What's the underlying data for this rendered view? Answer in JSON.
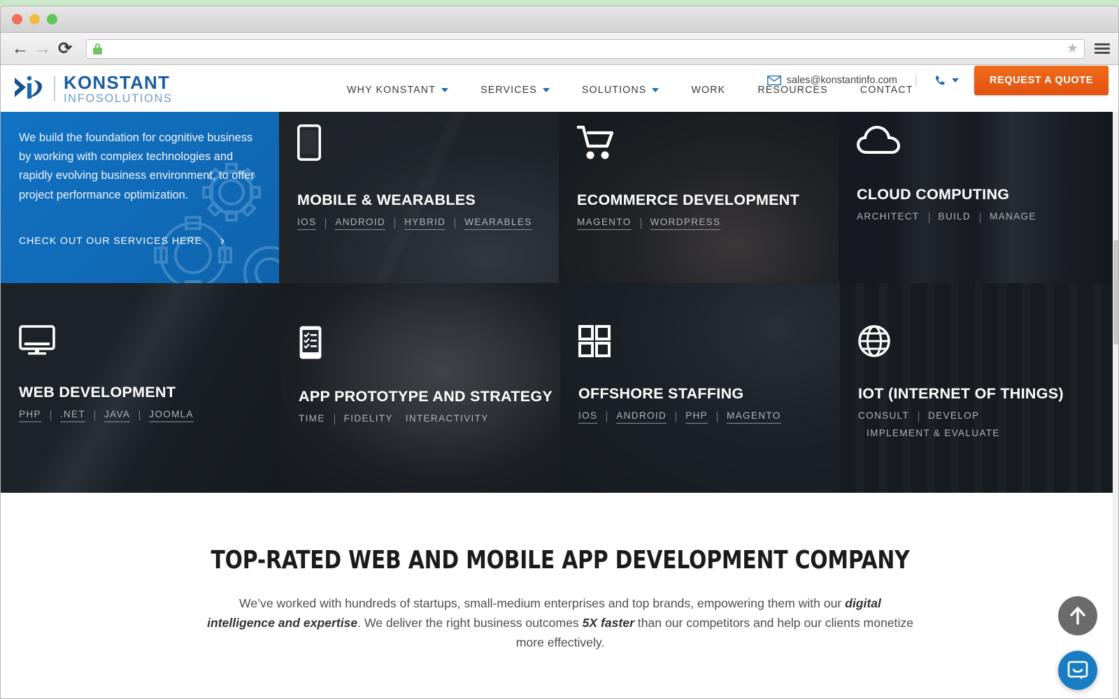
{
  "browser": {
    "back_icon": "back-arrow-icon",
    "forward_icon": "forward-arrow-icon",
    "reload_icon": "reload-icon",
    "url_value": "",
    "url_placeholder": "",
    "lock_icon": "secure-lock-icon",
    "bookmark_icon": "star-icon",
    "menu_icon": "hamburger-menu-icon"
  },
  "header": {
    "logo": {
      "primary": "KONSTANT",
      "secondary": "INFOSOLUTIONS"
    },
    "email": "sales@konstantinfo.com",
    "mail_icon": "envelope-icon",
    "phone_icon": "phone-icon",
    "quote_button": "REQUEST A QUOTE",
    "accent_orange": "#e2520f",
    "nav": [
      {
        "label": "WHY KONSTANT",
        "has_dropdown": true
      },
      {
        "label": "SERVICES",
        "has_dropdown": true
      },
      {
        "label": "SOLUTIONS",
        "has_dropdown": true
      },
      {
        "label": "WORK",
        "has_dropdown": false
      },
      {
        "label": "RESOURCES",
        "has_dropdown": false
      },
      {
        "label": "CONTACT",
        "has_dropdown": false
      }
    ]
  },
  "intro": {
    "text": "We build the foundation for cognitive business by working with complex technologies and rapidly evolving business environment, to offer project performance optimization.",
    "cta": "CHECK OUT OUR SERVICES HERE",
    "cta_arrow": "chevron-right-icon",
    "bg_color": "#1172c4",
    "decor_icon": "gears-icon"
  },
  "tiles": [
    {
      "title": "MOBILE & WEARABLES",
      "icon": "smartphone-icon",
      "tags": [
        "IOS",
        "ANDROID",
        "HYBRID",
        "WEARABLES"
      ],
      "underlined": true
    },
    {
      "title": "ECOMMERCE DEVELOPMENT",
      "icon": "shopping-cart-icon",
      "tags": [
        "MAGENTO",
        "WORDPRESS"
      ],
      "underlined": true
    },
    {
      "title": "CLOUD COMPUTING",
      "icon": "cloud-icon",
      "tags": [
        "ARCHITECT",
        "BUILD",
        "MANAGE"
      ],
      "underlined": false
    },
    {
      "title": "WEB DEVELOPMENT",
      "icon": "desktop-monitor-icon",
      "tags": [
        "PHP",
        ".NET",
        "JAVA",
        "JOOMLA"
      ],
      "underlined": true
    },
    {
      "title": "APP PROTOTYPE AND STRATEGY",
      "icon": "mobile-checklist-icon",
      "tags": [
        "TIME",
        "FIDELITY",
        "INTERACTIVITY"
      ],
      "underlined": false
    },
    {
      "title": "OFFSHORE STAFFING",
      "icon": "grid-squares-icon",
      "tags": [
        "IOS",
        "ANDROID",
        "PHP",
        "MAGENTO"
      ],
      "underlined": true
    },
    {
      "title": "IOT (INTERNET OF THINGS)",
      "icon": "globe-icon",
      "tags": [
        "CONSULT",
        "DEVELOP"
      ],
      "tags_line2": [
        "IMPLEMENT & EVALUATE"
      ],
      "underlined": false
    }
  ],
  "about": {
    "heading": "TOP-RATED WEB AND MOBILE APP DEVELOPMENT COMPANY",
    "paragraph_part1": "We’ve worked with hundreds of startups, small-medium enterprises and top brands, empowering them with our ",
    "paragraph_em1": "digital intelligence and expertise",
    "paragraph_part2": ". We deliver the right business outcomes ",
    "paragraph_em2": "5X faster",
    "paragraph_part3": " than our competitors and help our clients monetize more effectively."
  },
  "widgets": {
    "scroll_top_icon": "arrow-up-icon",
    "chat_icon": "chat-bubble-icon",
    "chat_color": "#1a7cc2"
  }
}
